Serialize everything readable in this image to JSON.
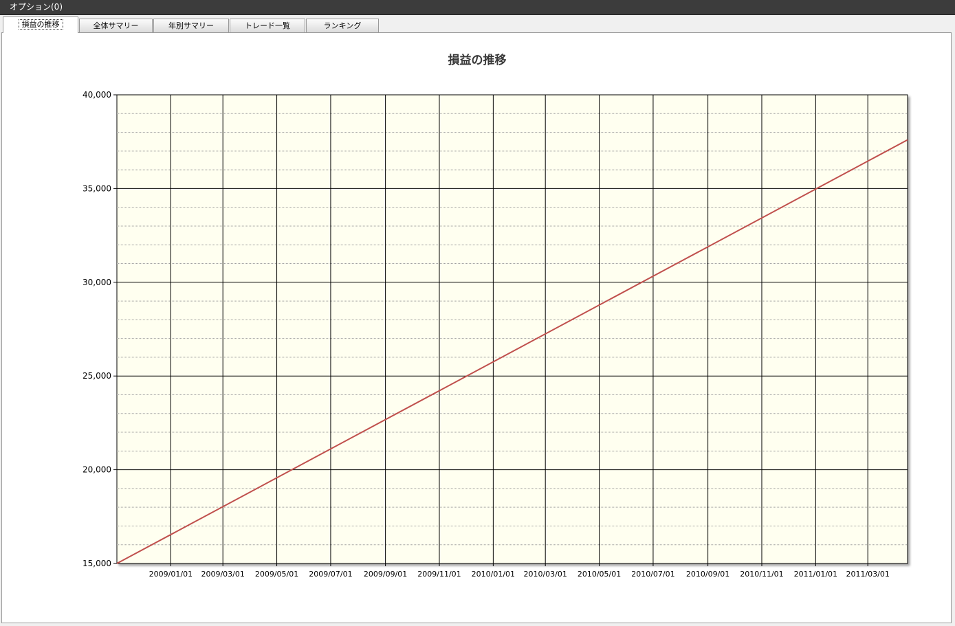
{
  "menu": {
    "options_label": "オプション(0)"
  },
  "tabs": [
    {
      "label": "損益の推移",
      "active": true
    },
    {
      "label": "全体サマリー",
      "active": false
    },
    {
      "label": "年別サマリー",
      "active": false
    },
    {
      "label": "トレード一覧",
      "active": false
    },
    {
      "label": "ランキング",
      "active": false
    }
  ],
  "colors": {
    "plot_background": "#fffff0",
    "series_line": "#c0504d",
    "grid_major": "#000000",
    "grid_minor": "#a0a0a0"
  },
  "chart_data": {
    "type": "line",
    "title": "損益の推移",
    "xlabel": "",
    "ylabel": "",
    "ylim": [
      15000,
      40000
    ],
    "y_ticks": [
      15000,
      20000,
      25000,
      30000,
      35000,
      40000
    ],
    "y_tick_labels": [
      "15,000",
      "20,000",
      "25,000",
      "30,000",
      "35,000",
      "40,000"
    ],
    "x_range": [
      "2008-11-01",
      "2011-04-15"
    ],
    "x_ticks": [
      "2009/01/01",
      "2009/03/01",
      "2009/05/01",
      "2009/07/01",
      "2009/09/01",
      "2009/11/01",
      "2010/01/01",
      "2010/03/01",
      "2010/05/01",
      "2010/07/01",
      "2010/09/01",
      "2010/11/01",
      "2011/01/01",
      "2011/03/01"
    ],
    "grid": true,
    "legend": "none",
    "series": [
      {
        "x": [
          "2008-11-01",
          "2011-04-15"
        ],
        "y": [
          15000,
          37600
        ]
      }
    ]
  }
}
